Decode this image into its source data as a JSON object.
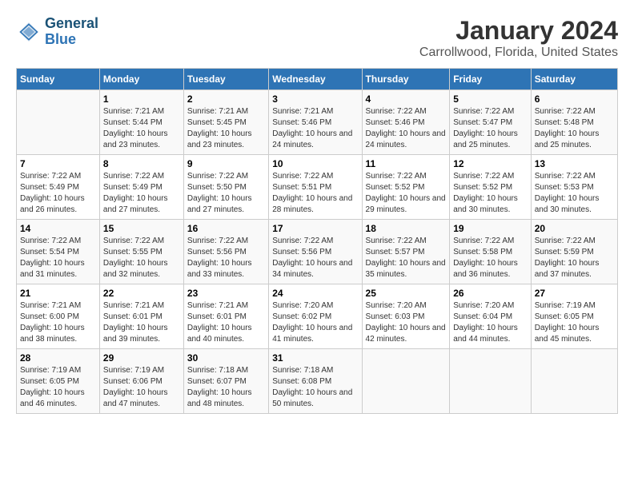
{
  "logo": {
    "line1": "General",
    "line2": "Blue"
  },
  "title": "January 2024",
  "subtitle": "Carrollwood, Florida, United States",
  "days_of_week": [
    "Sunday",
    "Monday",
    "Tuesday",
    "Wednesday",
    "Thursday",
    "Friday",
    "Saturday"
  ],
  "weeks": [
    [
      {
        "num": "",
        "sunrise": "",
        "sunset": "",
        "daylight": ""
      },
      {
        "num": "1",
        "sunrise": "Sunrise: 7:21 AM",
        "sunset": "Sunset: 5:44 PM",
        "daylight": "Daylight: 10 hours and 23 minutes."
      },
      {
        "num": "2",
        "sunrise": "Sunrise: 7:21 AM",
        "sunset": "Sunset: 5:45 PM",
        "daylight": "Daylight: 10 hours and 23 minutes."
      },
      {
        "num": "3",
        "sunrise": "Sunrise: 7:21 AM",
        "sunset": "Sunset: 5:46 PM",
        "daylight": "Daylight: 10 hours and 24 minutes."
      },
      {
        "num": "4",
        "sunrise": "Sunrise: 7:22 AM",
        "sunset": "Sunset: 5:46 PM",
        "daylight": "Daylight: 10 hours and 24 minutes."
      },
      {
        "num": "5",
        "sunrise": "Sunrise: 7:22 AM",
        "sunset": "Sunset: 5:47 PM",
        "daylight": "Daylight: 10 hours and 25 minutes."
      },
      {
        "num": "6",
        "sunrise": "Sunrise: 7:22 AM",
        "sunset": "Sunset: 5:48 PM",
        "daylight": "Daylight: 10 hours and 25 minutes."
      }
    ],
    [
      {
        "num": "7",
        "sunrise": "Sunrise: 7:22 AM",
        "sunset": "Sunset: 5:49 PM",
        "daylight": "Daylight: 10 hours and 26 minutes."
      },
      {
        "num": "8",
        "sunrise": "Sunrise: 7:22 AM",
        "sunset": "Sunset: 5:49 PM",
        "daylight": "Daylight: 10 hours and 27 minutes."
      },
      {
        "num": "9",
        "sunrise": "Sunrise: 7:22 AM",
        "sunset": "Sunset: 5:50 PM",
        "daylight": "Daylight: 10 hours and 27 minutes."
      },
      {
        "num": "10",
        "sunrise": "Sunrise: 7:22 AM",
        "sunset": "Sunset: 5:51 PM",
        "daylight": "Daylight: 10 hours and 28 minutes."
      },
      {
        "num": "11",
        "sunrise": "Sunrise: 7:22 AM",
        "sunset": "Sunset: 5:52 PM",
        "daylight": "Daylight: 10 hours and 29 minutes."
      },
      {
        "num": "12",
        "sunrise": "Sunrise: 7:22 AM",
        "sunset": "Sunset: 5:52 PM",
        "daylight": "Daylight: 10 hours and 30 minutes."
      },
      {
        "num": "13",
        "sunrise": "Sunrise: 7:22 AM",
        "sunset": "Sunset: 5:53 PM",
        "daylight": "Daylight: 10 hours and 30 minutes."
      }
    ],
    [
      {
        "num": "14",
        "sunrise": "Sunrise: 7:22 AM",
        "sunset": "Sunset: 5:54 PM",
        "daylight": "Daylight: 10 hours and 31 minutes."
      },
      {
        "num": "15",
        "sunrise": "Sunrise: 7:22 AM",
        "sunset": "Sunset: 5:55 PM",
        "daylight": "Daylight: 10 hours and 32 minutes."
      },
      {
        "num": "16",
        "sunrise": "Sunrise: 7:22 AM",
        "sunset": "Sunset: 5:56 PM",
        "daylight": "Daylight: 10 hours and 33 minutes."
      },
      {
        "num": "17",
        "sunrise": "Sunrise: 7:22 AM",
        "sunset": "Sunset: 5:56 PM",
        "daylight": "Daylight: 10 hours and 34 minutes."
      },
      {
        "num": "18",
        "sunrise": "Sunrise: 7:22 AM",
        "sunset": "Sunset: 5:57 PM",
        "daylight": "Daylight: 10 hours and 35 minutes."
      },
      {
        "num": "19",
        "sunrise": "Sunrise: 7:22 AM",
        "sunset": "Sunset: 5:58 PM",
        "daylight": "Daylight: 10 hours and 36 minutes."
      },
      {
        "num": "20",
        "sunrise": "Sunrise: 7:22 AM",
        "sunset": "Sunset: 5:59 PM",
        "daylight": "Daylight: 10 hours and 37 minutes."
      }
    ],
    [
      {
        "num": "21",
        "sunrise": "Sunrise: 7:21 AM",
        "sunset": "Sunset: 6:00 PM",
        "daylight": "Daylight: 10 hours and 38 minutes."
      },
      {
        "num": "22",
        "sunrise": "Sunrise: 7:21 AM",
        "sunset": "Sunset: 6:01 PM",
        "daylight": "Daylight: 10 hours and 39 minutes."
      },
      {
        "num": "23",
        "sunrise": "Sunrise: 7:21 AM",
        "sunset": "Sunset: 6:01 PM",
        "daylight": "Daylight: 10 hours and 40 minutes."
      },
      {
        "num": "24",
        "sunrise": "Sunrise: 7:20 AM",
        "sunset": "Sunset: 6:02 PM",
        "daylight": "Daylight: 10 hours and 41 minutes."
      },
      {
        "num": "25",
        "sunrise": "Sunrise: 7:20 AM",
        "sunset": "Sunset: 6:03 PM",
        "daylight": "Daylight: 10 hours and 42 minutes."
      },
      {
        "num": "26",
        "sunrise": "Sunrise: 7:20 AM",
        "sunset": "Sunset: 6:04 PM",
        "daylight": "Daylight: 10 hours and 44 minutes."
      },
      {
        "num": "27",
        "sunrise": "Sunrise: 7:19 AM",
        "sunset": "Sunset: 6:05 PM",
        "daylight": "Daylight: 10 hours and 45 minutes."
      }
    ],
    [
      {
        "num": "28",
        "sunrise": "Sunrise: 7:19 AM",
        "sunset": "Sunset: 6:05 PM",
        "daylight": "Daylight: 10 hours and 46 minutes."
      },
      {
        "num": "29",
        "sunrise": "Sunrise: 7:19 AM",
        "sunset": "Sunset: 6:06 PM",
        "daylight": "Daylight: 10 hours and 47 minutes."
      },
      {
        "num": "30",
        "sunrise": "Sunrise: 7:18 AM",
        "sunset": "Sunset: 6:07 PM",
        "daylight": "Daylight: 10 hours and 48 minutes."
      },
      {
        "num": "31",
        "sunrise": "Sunrise: 7:18 AM",
        "sunset": "Sunset: 6:08 PM",
        "daylight": "Daylight: 10 hours and 50 minutes."
      },
      {
        "num": "",
        "sunrise": "",
        "sunset": "",
        "daylight": ""
      },
      {
        "num": "",
        "sunrise": "",
        "sunset": "",
        "daylight": ""
      },
      {
        "num": "",
        "sunrise": "",
        "sunset": "",
        "daylight": ""
      }
    ]
  ]
}
